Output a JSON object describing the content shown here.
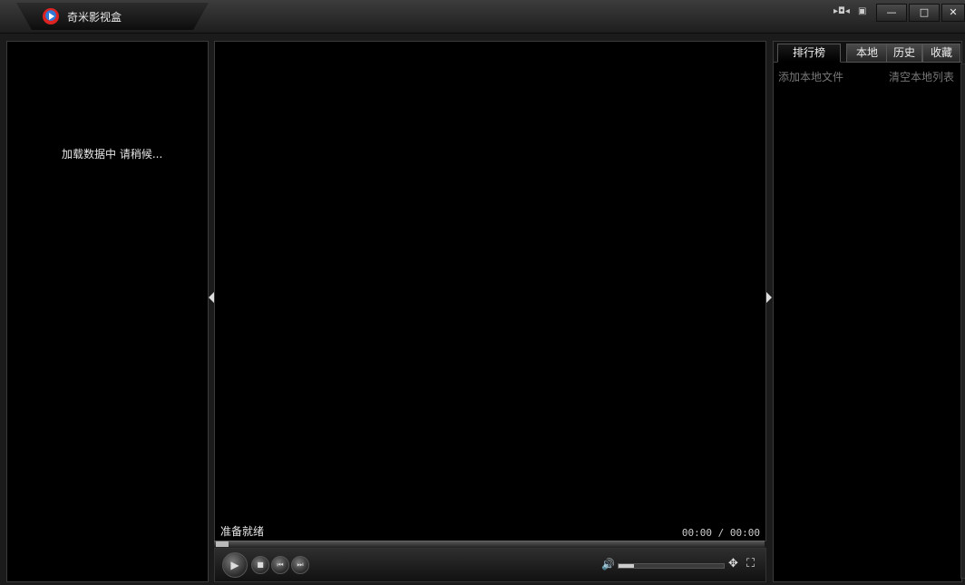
{
  "window": {
    "title": "奇米影视盒",
    "controls": {
      "minimize": "—",
      "maximize": "□",
      "close": "✕",
      "mini_mode": "▸◘◂",
      "menu": "▣"
    }
  },
  "left_panel": {
    "loading_text": "加载数据中 请稍候..."
  },
  "player": {
    "status": "准备就绪",
    "time": "00:00 / 00:00",
    "controls": {
      "play": "▶",
      "stop": "■",
      "prev": "⏮",
      "next": "⏭",
      "volume": "🔊",
      "settings": "✥",
      "fullscreen": "⛶"
    },
    "volume_level": 0.15
  },
  "right_panel": {
    "tabs": [
      "排行榜",
      "本地",
      "历史",
      "收藏"
    ],
    "active_tab": "排行榜",
    "add_local": "添加本地文件",
    "clear_local": "清空本地列表"
  }
}
